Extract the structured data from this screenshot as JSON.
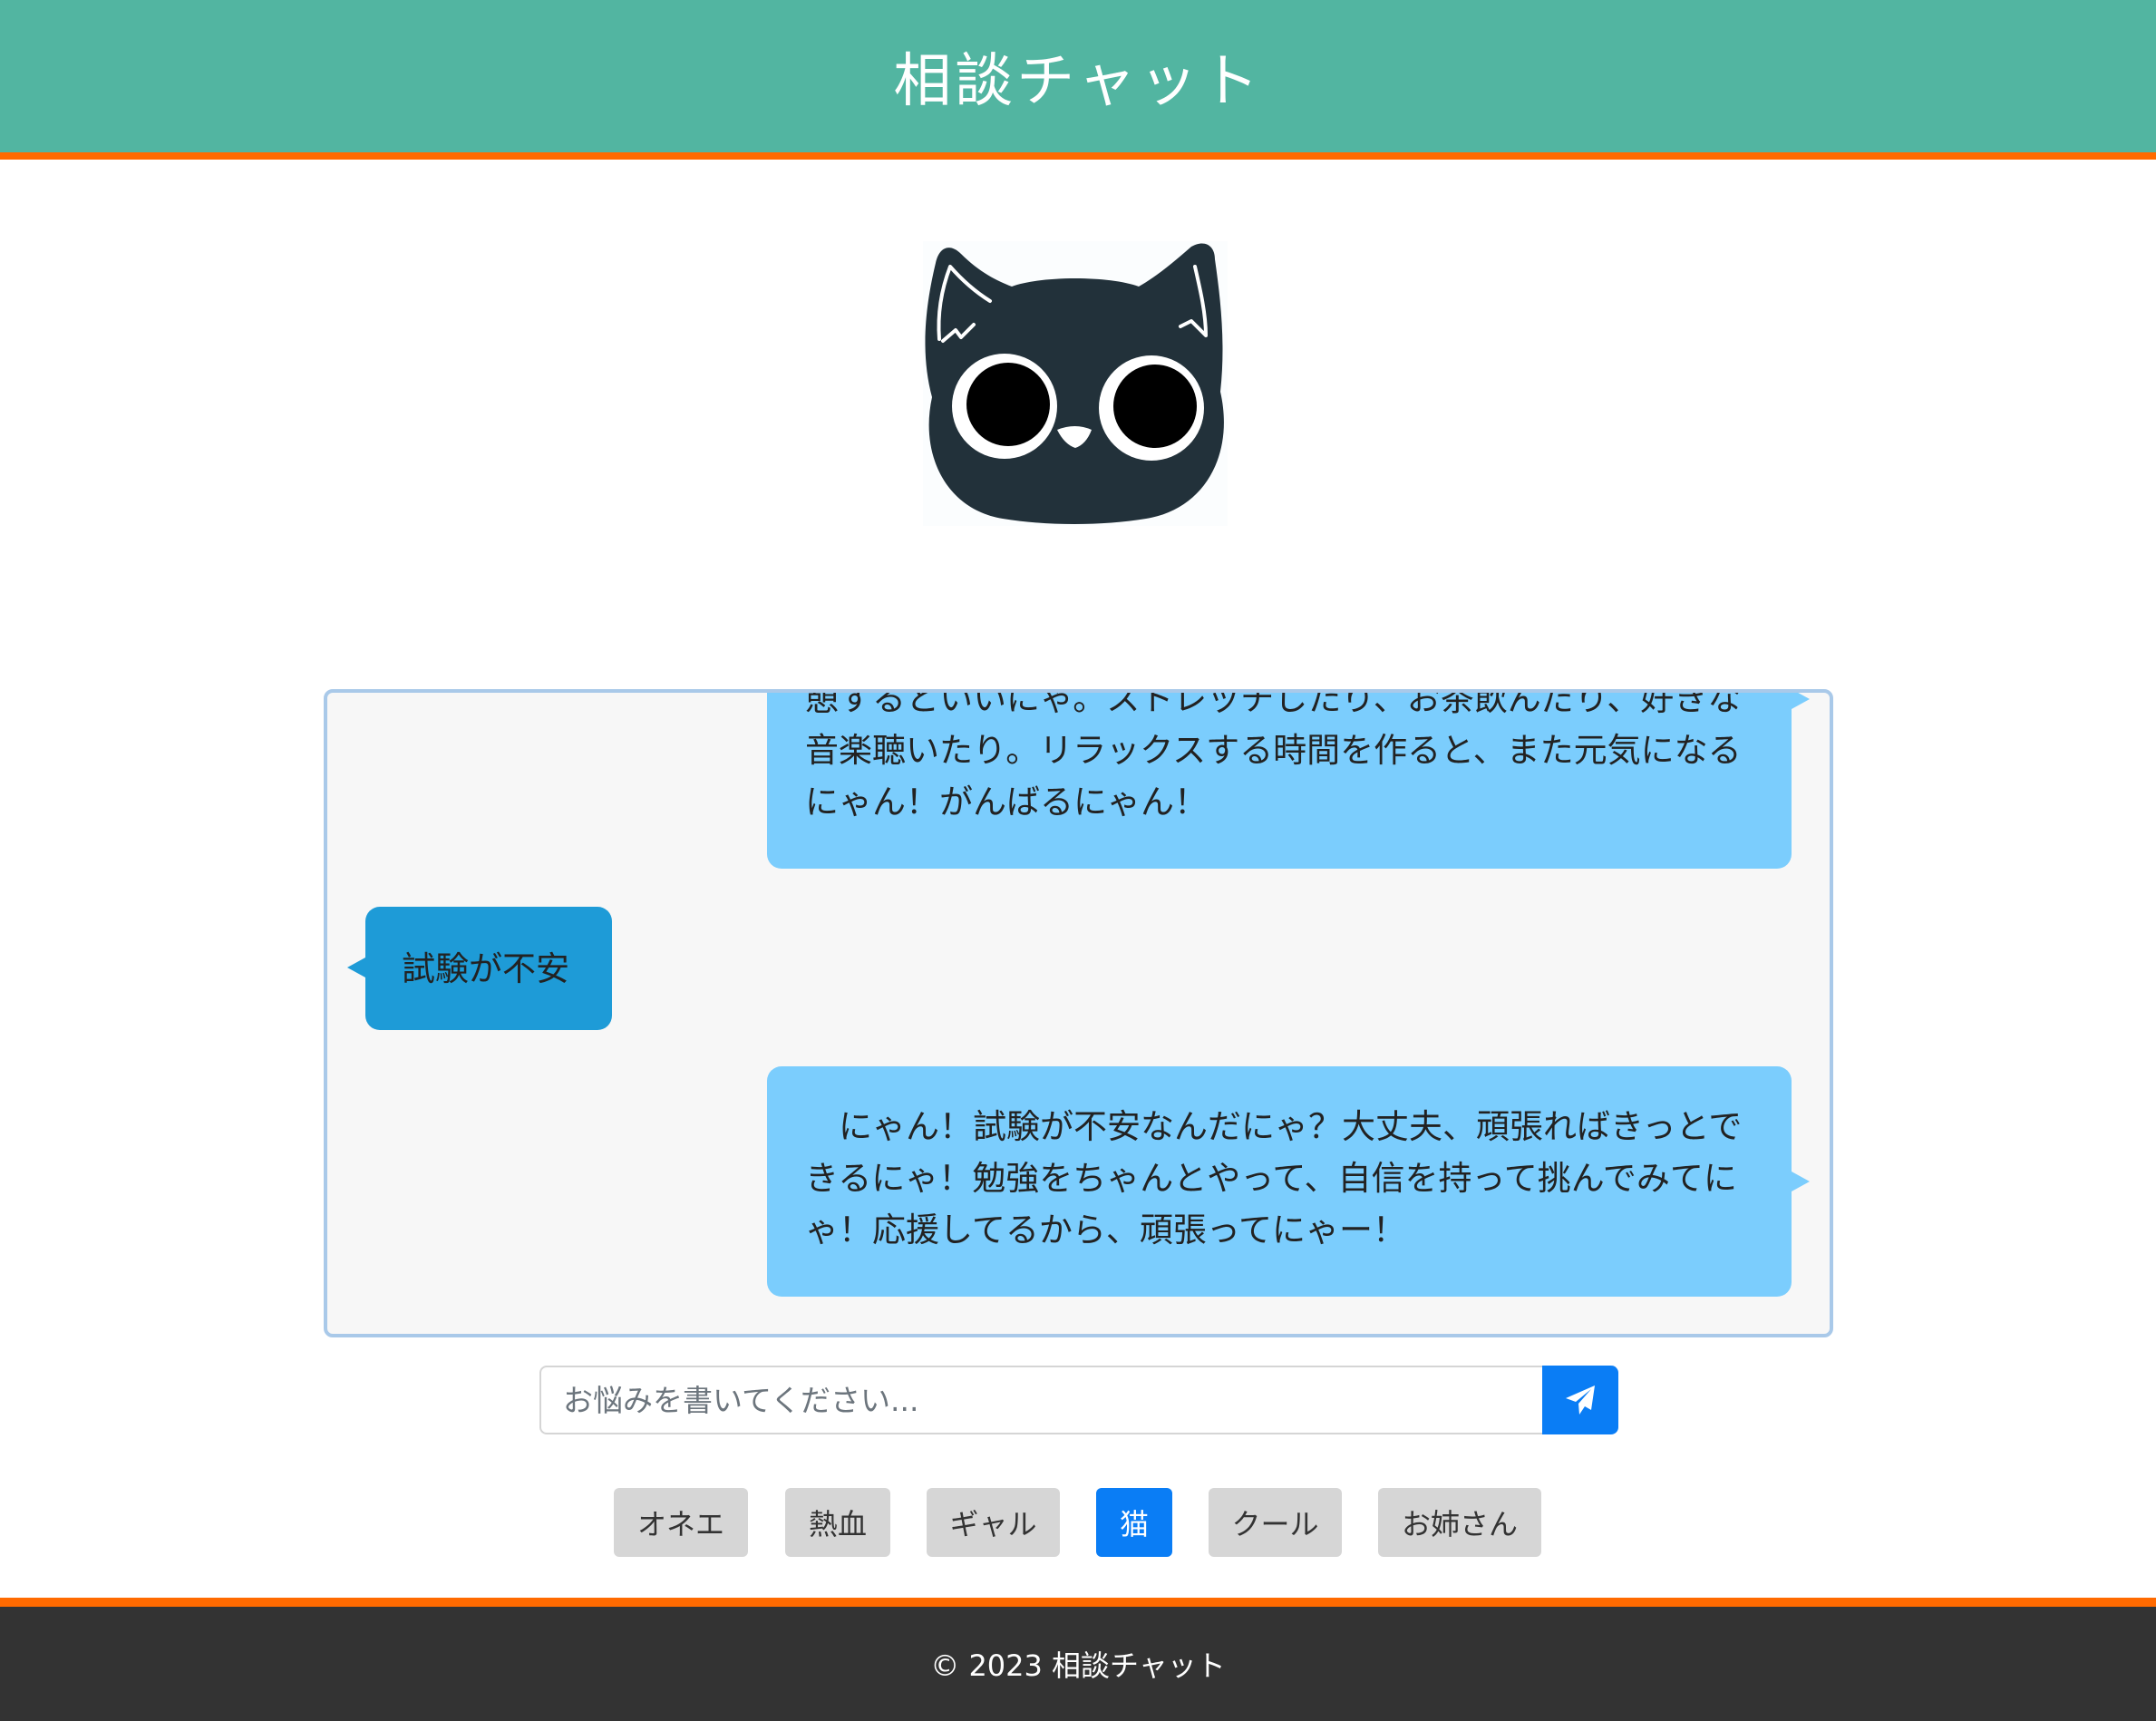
{
  "header": {
    "title": "相談チャット"
  },
  "avatar": {
    "icon": "cat-face-icon"
  },
  "messages": [
    {
      "role": "bot",
      "text": "憩するといいにゃ。ストレッチしたり、お茶飲んだり、好きな音楽聴いたり。リラックスする時間を作ると、また元気になるにゃん！がんばるにゃん！"
    },
    {
      "role": "user",
      "text": "試験が不安"
    },
    {
      "role": "bot",
      "text": "　にゃん！試験が不安なんだにゃ？大丈夫、頑張ればきっとできるにゃ！勉強をちゃんとやって、自信を持って挑んでみてにゃ！応援してるから、頑張ってにゃー！"
    }
  ],
  "input": {
    "placeholder": "お悩みを書いてください...",
    "value": ""
  },
  "send_button": {
    "icon": "paper-plane-icon"
  },
  "personas": [
    {
      "label": "オネエ",
      "active": false
    },
    {
      "label": "熱血",
      "active": false
    },
    {
      "label": "ギャル",
      "active": false
    },
    {
      "label": "猫",
      "active": true
    },
    {
      "label": "クール",
      "active": false
    },
    {
      "label": "お姉さん",
      "active": false
    }
  ],
  "footer": {
    "text": "© 2023 相談チャット"
  },
  "colors": {
    "header_bg": "#52b5a1",
    "accent_orange": "#ff6a00",
    "bot_bubble": "#7bcdfd",
    "user_bubble": "#1e9bd7",
    "primary_button": "#0a7df5",
    "footer_bg": "#333333"
  }
}
